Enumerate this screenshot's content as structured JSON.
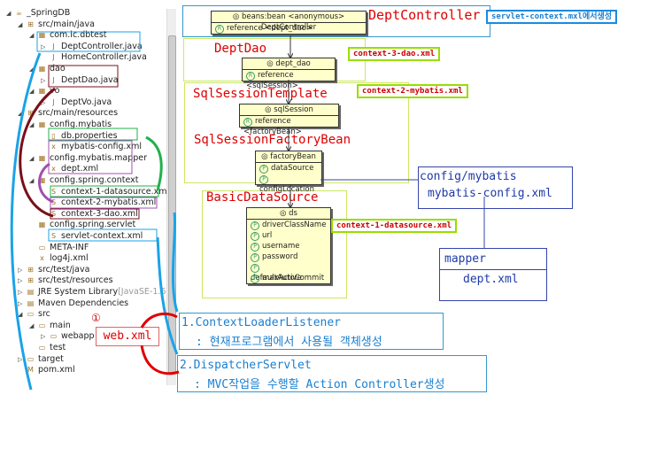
{
  "tree": [
    {
      "label": "_SpringDB",
      "level": 0,
      "tw": "◢",
      "icon": "project-icon"
    },
    {
      "label": "src/main/java",
      "level": 1,
      "tw": "◢",
      "icon": "source-folder-icon"
    },
    {
      "label": "com.ic.dbtest",
      "level": 2,
      "tw": "◢",
      "icon": "package-icon"
    },
    {
      "label": "DeptController.java",
      "level": 3,
      "tw": "▷",
      "icon": "java-file-icon"
    },
    {
      "label": "HomeController.java",
      "level": 3,
      "tw": "",
      "icon": "java-file-icon"
    },
    {
      "label": "dao",
      "level": 2,
      "tw": "◢",
      "icon": "package-icon"
    },
    {
      "label": "DeptDao.java",
      "level": 3,
      "tw": "▷",
      "icon": "java-file-icon"
    },
    {
      "label": "vo",
      "level": 2,
      "tw": "◢",
      "icon": "package-icon"
    },
    {
      "label": "DeptVo.java",
      "level": 3,
      "tw": "▷",
      "icon": "java-file-icon"
    },
    {
      "label": "src/main/resources",
      "level": 1,
      "tw": "◢",
      "icon": "source-folder-icon"
    },
    {
      "label": "config.mybatis",
      "level": 2,
      "tw": "◢",
      "icon": "package-icon"
    },
    {
      "label": "db.properties",
      "level": 3,
      "tw": "",
      "icon": "file-icon"
    },
    {
      "label": "mybatis-config.xml",
      "level": 3,
      "tw": "",
      "icon": "xml-file-icon"
    },
    {
      "label": "config.mybatis.mapper",
      "level": 2,
      "tw": "◢",
      "icon": "package-icon"
    },
    {
      "label": "dept.xml",
      "level": 3,
      "tw": "",
      "icon": "xml-file-icon"
    },
    {
      "label": "config.spring.context",
      "level": 2,
      "tw": "◢",
      "icon": "package-icon"
    },
    {
      "label": "context-1-datasource.xml",
      "level": 3,
      "tw": "",
      "icon": "spring-xml-icon"
    },
    {
      "label": "context-2-mybatis.xml",
      "level": 3,
      "tw": "",
      "icon": "spring-xml-icon"
    },
    {
      "label": "context-3-dao.xml",
      "level": 3,
      "tw": "",
      "icon": "spring-xml-icon"
    },
    {
      "label": "config.spring.servlet",
      "level": 2,
      "tw": "",
      "icon": "package-icon"
    },
    {
      "label": "servlet-context.xml",
      "level": 3,
      "tw": "",
      "icon": "spring-xml-icon"
    },
    {
      "label": "META-INF",
      "level": 2,
      "tw": "",
      "icon": "folder-icon"
    },
    {
      "label": "log4j.xml",
      "level": 2,
      "tw": "",
      "icon": "xml-file-icon"
    },
    {
      "label": "src/test/java",
      "level": 1,
      "tw": "▷",
      "icon": "source-folder-icon"
    },
    {
      "label": "src/test/resources",
      "level": 1,
      "tw": "▷",
      "icon": "source-folder-icon"
    },
    {
      "label": "JRE System Library",
      "suffix": " [JavaSE-1.6]",
      "level": 1,
      "tw": "▷",
      "icon": "library-icon"
    },
    {
      "label": "Maven Dependencies",
      "level": 1,
      "tw": "▷",
      "icon": "library-icon"
    },
    {
      "label": "src",
      "level": 1,
      "tw": "◢",
      "icon": "folder-icon"
    },
    {
      "label": "main",
      "level": 2,
      "tw": "◢",
      "icon": "folder-icon"
    },
    {
      "label": "webapp",
      "level": 3,
      "tw": "▷",
      "icon": "folder-icon"
    },
    {
      "label": "test",
      "level": 2,
      "tw": "",
      "icon": "folder-icon"
    },
    {
      "label": "target",
      "level": 1,
      "tw": "▷",
      "icon": "folder-icon"
    },
    {
      "label": "pom.xml",
      "level": 1,
      "tw": "",
      "icon": "maven-file-icon"
    }
  ],
  "beans": {
    "controller": {
      "title": "beans:bean <anonymous> DeptController",
      "rows": [
        "reference <dept_dao>"
      ]
    },
    "dao": {
      "title": "dept_dao",
      "rows": [
        "reference <sqlSession>"
      ]
    },
    "session": {
      "title": "sqlSession",
      "rows": [
        "reference <factoryBean>"
      ]
    },
    "factory": {
      "title": "factoryBean",
      "rows": [
        "dataSource",
        "configLocation"
      ]
    },
    "ds": {
      "title": "ds",
      "rows": [
        "driverClassName",
        "url",
        "username",
        "password",
        "defaultAutoCommit",
        "maxActive"
      ]
    }
  },
  "labels": {
    "deptcontroller": "DeptController",
    "deptdao": "DeptDao",
    "sqlsessiontemplate": "SqlSessionTemplate",
    "sqlsessionfactorybean": "SqlSessionFactoryBean",
    "basicdatasource": "BasicDataSource",
    "servlet_context": "servlet-context.mxl에서생성",
    "ctx3": "context-3-dao.xml",
    "ctx2": "context-2-mybatis.xml",
    "ctx1": "context-1-datasource.xml",
    "config_line1": "config/mybatis",
    "config_line2": "mybatis-config.xml",
    "mapper": "mapper",
    "dept_xml": "dept.xml",
    "circle_one": "①",
    "web_xml": "web.xml",
    "listener_title": "1.ContextLoaderListener",
    "listener_desc": ": 현재프로그램에서 사용될 객체생성",
    "dispatcher_title": "2.DispatcherServlet",
    "dispatcher_desc": ": MVC작업을 수행할 Action Controller생성"
  },
  "colors": {
    "blue_arrow": "#1aa3e8",
    "red_arrow": "#e00000",
    "maroon_arrow": "#7a0f1a",
    "green_arrow": "#22b04a",
    "purple_arrow": "#a050b0",
    "bean_fill": "#ffffcc"
  }
}
